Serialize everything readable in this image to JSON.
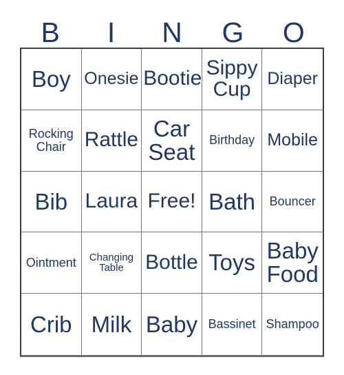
{
  "card": {
    "title": "BINGO",
    "text_color": "#1F3864",
    "border_color": "#767676",
    "outer_border_color": "#3d3d3d",
    "background": "#ffffff"
  },
  "header": {
    "letters": [
      {
        "label": "B"
      },
      {
        "label": "I"
      },
      {
        "label": "N"
      },
      {
        "label": "G"
      },
      {
        "label": "O"
      }
    ]
  },
  "grid": {
    "rows": 5,
    "columns": 5,
    "free_space": "Free!",
    "cells": [
      {
        "label": "Boy",
        "size": "xl"
      },
      {
        "label": "Onesie",
        "size": "md"
      },
      {
        "label": "Bootie",
        "size": "lg"
      },
      {
        "label": "Sippy Cup",
        "size": "lg"
      },
      {
        "label": "Diaper",
        "size": "md"
      },
      {
        "label": "Rocking Chair",
        "size": "sm"
      },
      {
        "label": "Rattle",
        "size": "lg"
      },
      {
        "label": "Car Seat",
        "size": "xl"
      },
      {
        "label": "Birthday",
        "size": "sm"
      },
      {
        "label": "Mobile",
        "size": "md"
      },
      {
        "label": "Bib",
        "size": "xl"
      },
      {
        "label": "Laura",
        "size": "lg"
      },
      {
        "label": "Free!",
        "size": "lg"
      },
      {
        "label": "Bath",
        "size": "xl"
      },
      {
        "label": "Bouncer",
        "size": "sm"
      },
      {
        "label": "Ointment",
        "size": "sm"
      },
      {
        "label": "Changing Table",
        "size": "xs"
      },
      {
        "label": "Bottle",
        "size": "lg"
      },
      {
        "label": "Toys",
        "size": "xl"
      },
      {
        "label": "Baby Food",
        "size": "xl"
      },
      {
        "label": "Crib",
        "size": "xl"
      },
      {
        "label": "Milk",
        "size": "xl"
      },
      {
        "label": "Baby",
        "size": "xl"
      },
      {
        "label": "Bassinet",
        "size": "sm"
      },
      {
        "label": "Shampoo",
        "size": "sm"
      }
    ]
  }
}
